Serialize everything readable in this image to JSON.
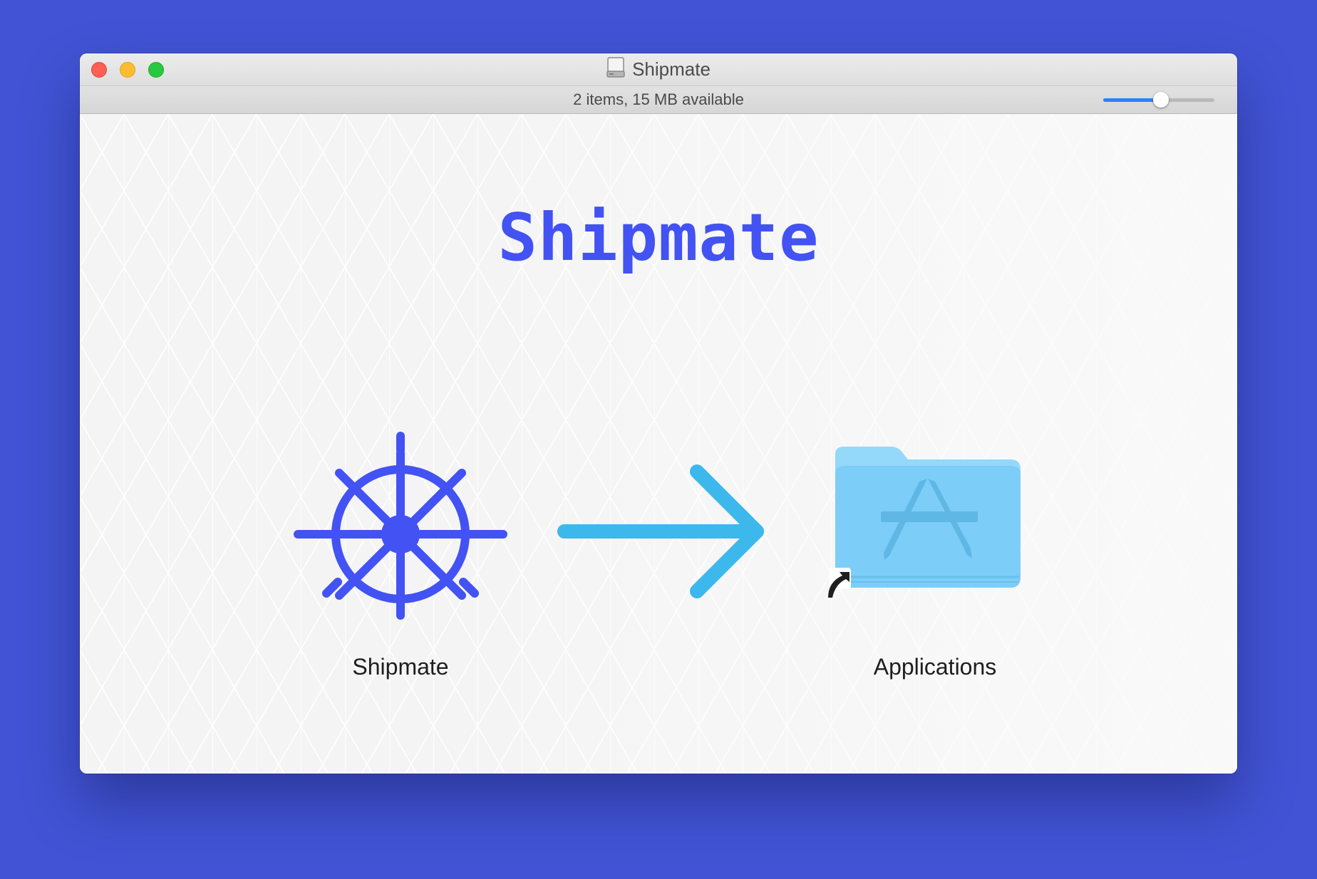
{
  "window": {
    "title": "Shipmate",
    "status": "2 items, 15 MB available",
    "icon_size_slider": {
      "value_fraction": 0.52
    }
  },
  "content": {
    "brand_title": "Shipmate",
    "items": [
      {
        "label": "Shipmate",
        "icon": "ship-wheel-icon"
      },
      {
        "label": "Applications",
        "icon": "applications-folder-icon",
        "alias": true
      }
    ],
    "arrow_icon": "arrow-right-icon"
  },
  "colors": {
    "desktop": "#4254d5",
    "brand": "#4352f2",
    "arrow": "#3db8ec",
    "folder": "#7ccdf7"
  }
}
